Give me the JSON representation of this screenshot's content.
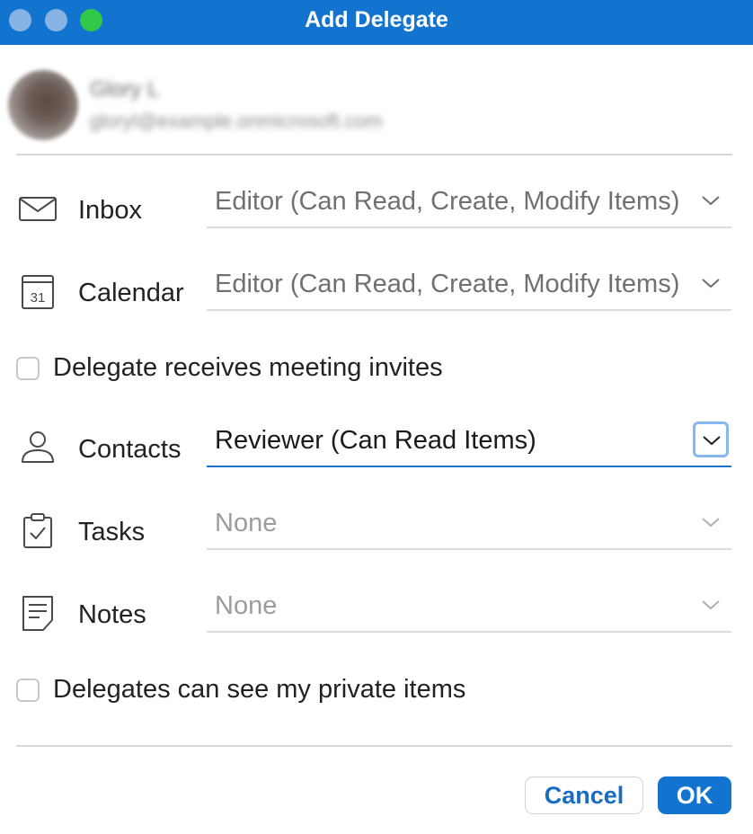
{
  "window": {
    "title": "Add Delegate"
  },
  "user": {
    "name": "Glory L",
    "email": "gloryl@example.onmicrosoft.com"
  },
  "permissions": [
    {
      "label": "Inbox",
      "icon": "envelope-icon",
      "value": "Editor (Can Read, Create, Modify Items)"
    },
    {
      "label": "Calendar",
      "icon": "calendar-icon",
      "value": "Editor (Can Read, Create, Modify Items)",
      "icon_text": "31"
    },
    {
      "label": "Contacts",
      "icon": "person-icon",
      "value": "Reviewer (Can Read Items)"
    },
    {
      "label": "Tasks",
      "icon": "clipboard-check-icon",
      "value": "None"
    },
    {
      "label": "Notes",
      "icon": "note-icon",
      "value": "None"
    }
  ],
  "checkboxes": {
    "meeting_invites": {
      "label": "Delegate receives meeting invites",
      "checked": false
    },
    "private_items": {
      "label": "Delegates can see my private items",
      "checked": false
    }
  },
  "buttons": {
    "cancel": "Cancel",
    "ok": "OK"
  },
  "colors": {
    "accent": "#1374d0",
    "focus_ring": "#8ab6ef",
    "close_minimize_dots": "#86b3e4",
    "zoom_dot": "#30c848"
  }
}
